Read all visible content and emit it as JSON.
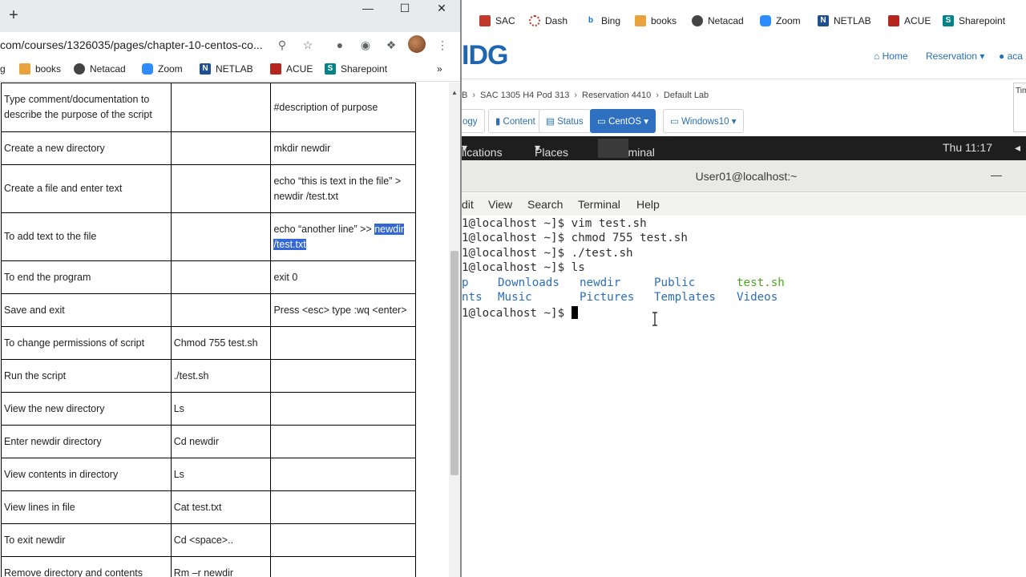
{
  "left_browser": {
    "url": "com/courses/1326035/pages/chapter-10-centos-co...",
    "bookmarks": [
      "g",
      "books",
      "Netacad",
      "Zoom",
      "NETLAB",
      "ACUE",
      "Sharepoint"
    ],
    "table_rows": [
      {
        "task": "Type comment/documentation to describe the purpose of the script",
        "command": "",
        "example": "#description of purpose"
      },
      {
        "task": "Create a new directory",
        "command": "",
        "example": "mkdir newdir"
      },
      {
        "task": "Create a file and enter text",
        "command": "",
        "example": "echo “this is text in the file” > newdir /test.txt"
      },
      {
        "task": "To add text to the file",
        "command": "",
        "example_plain": "echo “another line” >> ",
        "example_hl1": "newdir",
        "example_hl2": "/test.txt"
      },
      {
        "task": "To end the program",
        "command": "",
        "example": "exit 0"
      },
      {
        "task": "Save and exit",
        "command": "",
        "example": "Press <esc> type :wq <enter>"
      },
      {
        "task": "To change permissions of script",
        "command": "Chmod 755 test.sh",
        "example": ""
      },
      {
        "task": "Run the script",
        "command": "./test.sh",
        "example": ""
      },
      {
        "task": "View the new directory",
        "command": "Ls",
        "example": ""
      },
      {
        "task": "Enter newdir directory",
        "command": "Cd newdir",
        "example": ""
      },
      {
        "task": "View contents in directory",
        "command": "Ls",
        "example": ""
      },
      {
        "task": "View lines in file",
        "command": "Cat test.txt",
        "example": ""
      },
      {
        "task": "To exit newdir",
        "command": "Cd <space>..",
        "example": ""
      },
      {
        "task": "Remove directory and contents",
        "command": "Rm –r newdir",
        "example": ""
      }
    ]
  },
  "right_browser": {
    "bookmarks": [
      "SAC",
      "Dash",
      "Bing",
      "books",
      "Netacad",
      "Zoom",
      "NETLAB",
      "ACUE",
      "Sharepoint"
    ],
    "logo": "IDG",
    "nav": {
      "home": "Home",
      "reservation": "Reservation",
      "user": "aca"
    },
    "breadcrumbs": [
      "B",
      "SAC 1305 H4 Pod 313",
      "Reservation 4410",
      "Default Lab"
    ],
    "side_info": "Tim",
    "tabs": {
      "topology": "ogy",
      "content": "Content",
      "status": "Status",
      "centos": "CentOS",
      "windows": "Windows10"
    }
  },
  "centos": {
    "applications": "lications",
    "places": "Places",
    "terminal": "Terminal",
    "clock": "Thu 11:17",
    "window_title": "User01@localhost:~",
    "menu": [
      "dit",
      "View",
      "Search",
      "Terminal",
      "Help"
    ],
    "lines": [
      "1@localhost ~]$ vim test.sh",
      "1@localhost ~]$ chmod 755 test.sh",
      "1@localhost ~]$ ./test.sh",
      "1@localhost ~]$ ls"
    ],
    "ls_row1": [
      "p",
      "Downloads",
      "newdir",
      "Public",
      "test.sh"
    ],
    "ls_row2": [
      "nts",
      "Music",
      "Pictures",
      "Templates",
      "Videos"
    ],
    "prompt": "1@localhost ~]$ "
  }
}
